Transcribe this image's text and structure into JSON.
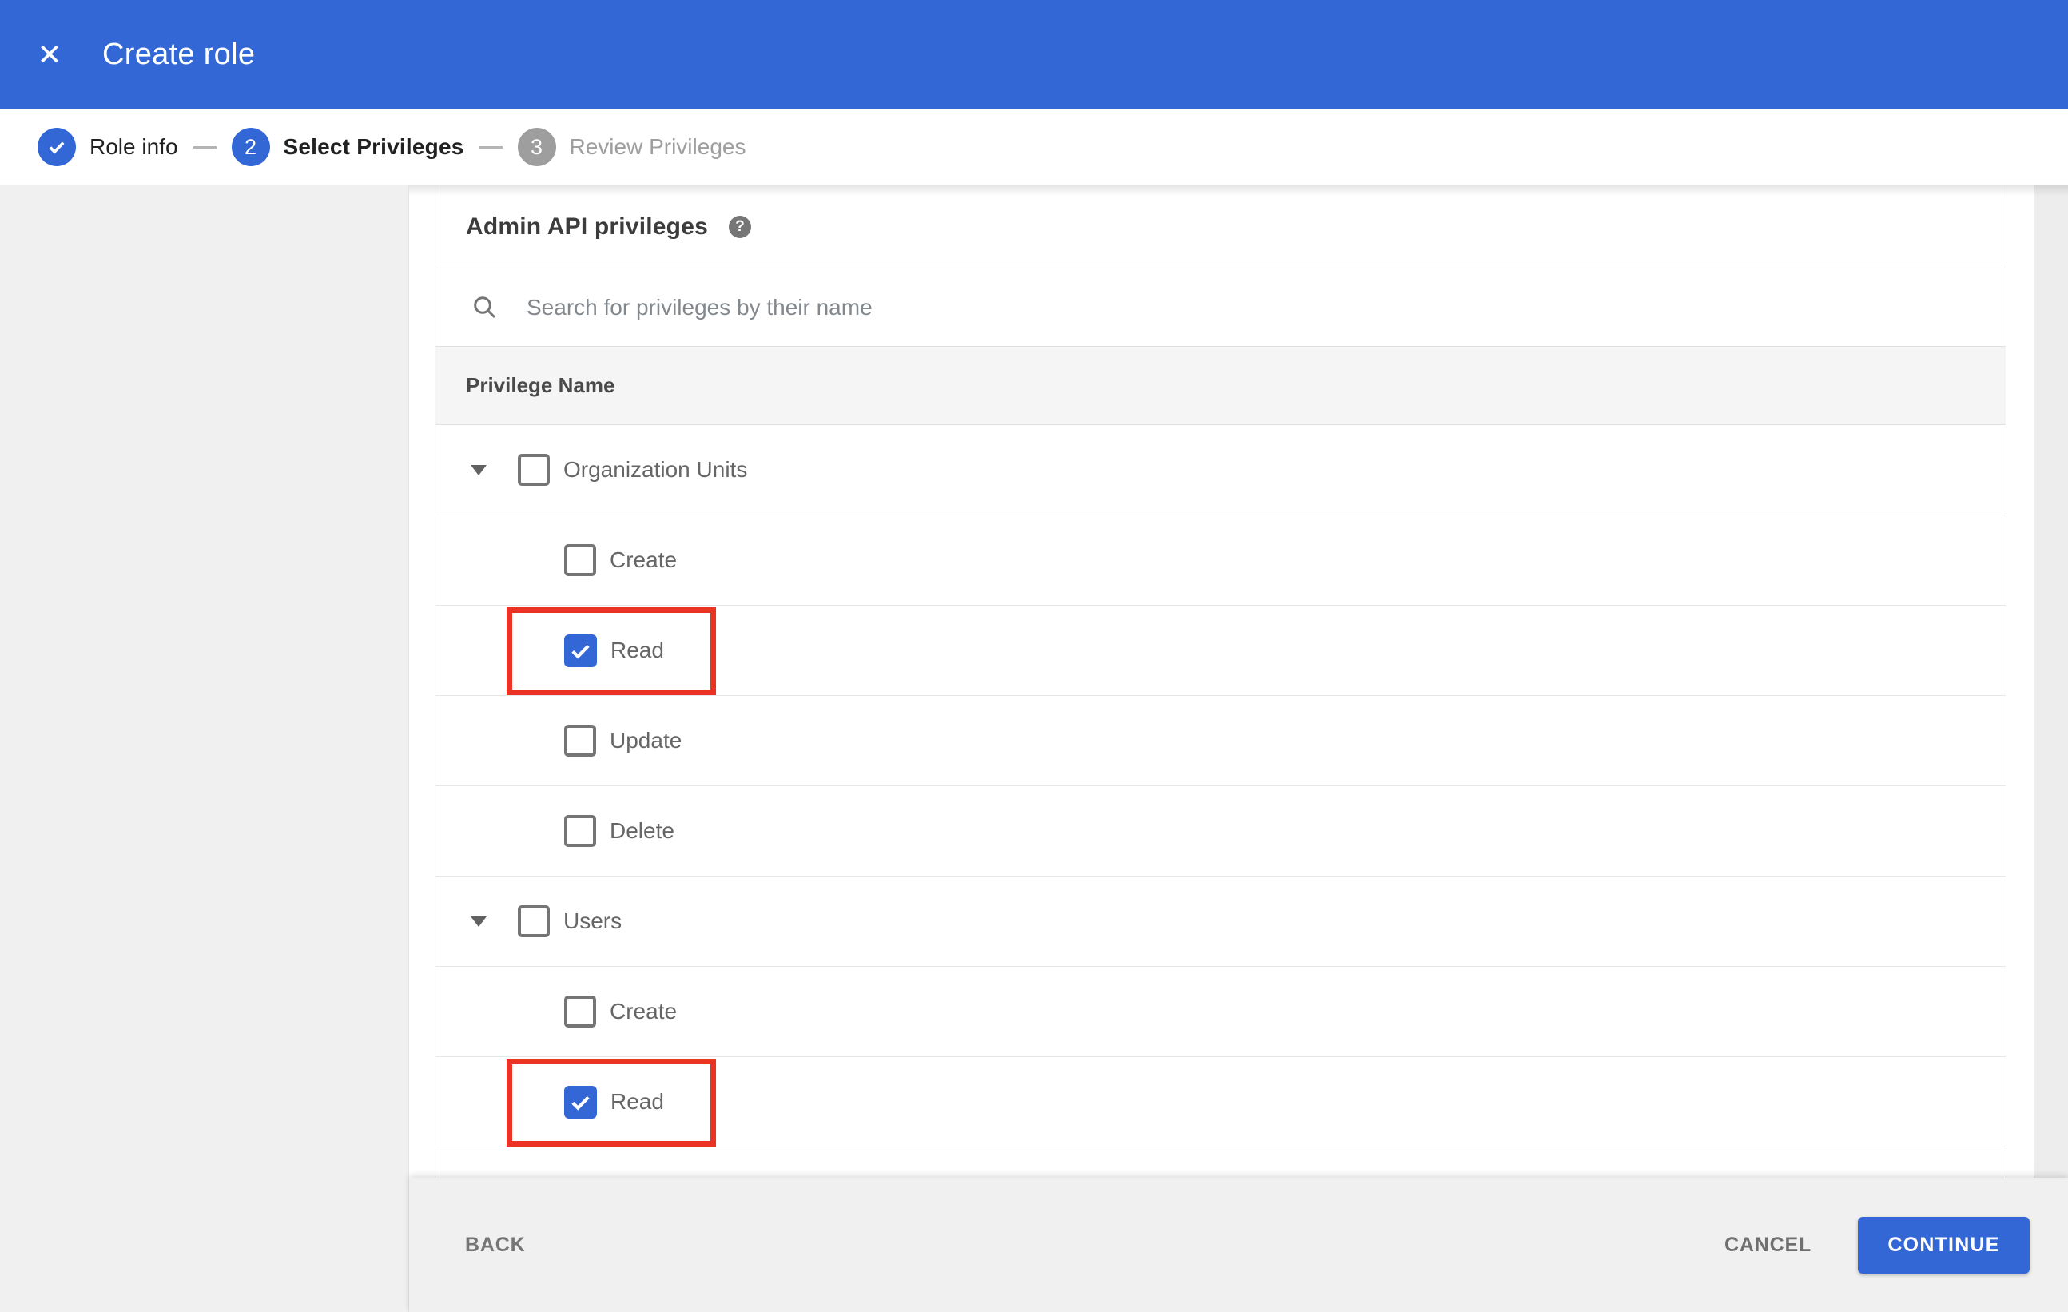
{
  "header": {
    "title": "Create role"
  },
  "icons": {
    "close_glyph": "✕",
    "help_glyph": "?"
  },
  "stepper": {
    "steps": [
      {
        "label": "Role info",
        "number": "",
        "state": "completed"
      },
      {
        "label": "Select Privileges",
        "number": "2",
        "state": "active"
      },
      {
        "label": "Review Privileges",
        "number": "3",
        "state": "inactive"
      }
    ]
  },
  "panel": {
    "title": "Admin API privileges",
    "search_placeholder": "Search for privileges by their name",
    "table_header": "Privilege Name",
    "rows": [
      {
        "label": "Organization Units",
        "level": "parent",
        "checked": false,
        "expanded": true,
        "highlighted": false
      },
      {
        "label": "Create",
        "level": "child",
        "checked": false,
        "highlighted": false
      },
      {
        "label": "Read",
        "level": "child",
        "checked": true,
        "highlighted": true
      },
      {
        "label": "Update",
        "level": "child",
        "checked": false,
        "highlighted": false
      },
      {
        "label": "Delete",
        "level": "child",
        "checked": false,
        "highlighted": false
      },
      {
        "label": "Users",
        "level": "parent",
        "checked": false,
        "expanded": true,
        "highlighted": false
      },
      {
        "label": "Create",
        "level": "child",
        "checked": false,
        "highlighted": false
      },
      {
        "label": "Read",
        "level": "child",
        "checked": true,
        "highlighted": true
      }
    ]
  },
  "footer": {
    "back_label": "BACK",
    "cancel_label": "CANCEL",
    "continue_label": "CONTINUE"
  },
  "colors": {
    "accent-blue": "#3367d6",
    "annotation-red": "#ea3323",
    "step-inactive": "#9e9e9e",
    "page-gray": "#f0f0f0",
    "table-header-bg": "#f5f5f5",
    "divider": "#e0e0e0"
  }
}
